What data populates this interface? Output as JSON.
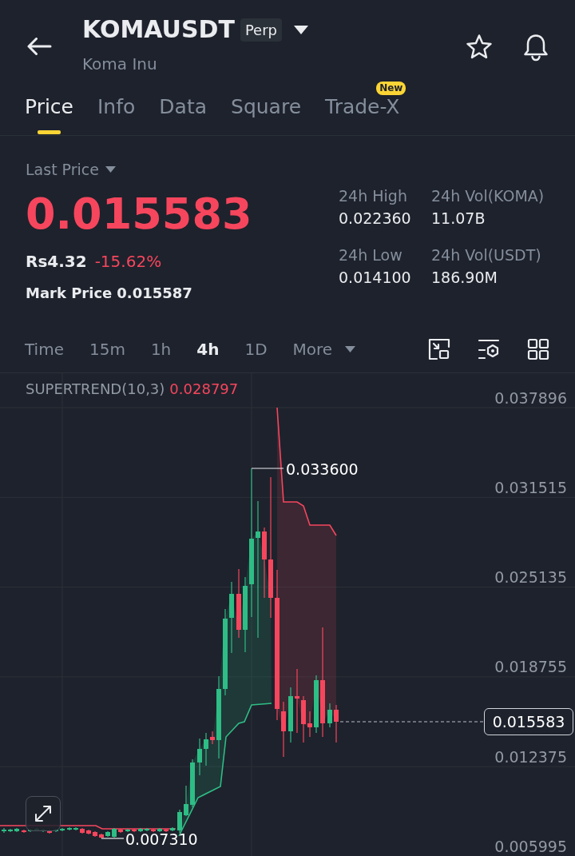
{
  "header": {
    "symbol": "KOMAUSDT",
    "contract_type": "Perp",
    "name": "Koma Inu"
  },
  "tabs": [
    {
      "label": "Price",
      "selected": true
    },
    {
      "label": "Info",
      "selected": false
    },
    {
      "label": "Data",
      "selected": false
    },
    {
      "label": "Square",
      "selected": false
    },
    {
      "label": "Trade-X",
      "selected": false,
      "badge": "New"
    }
  ],
  "price_panel": {
    "price_type": "Last Price",
    "last_price": "0.015583",
    "negative": true,
    "fiat_price": "Rs4.32",
    "change": "-15.62%",
    "mark_price_label": "Mark Price",
    "mark_price": "0.015587",
    "stats": [
      {
        "label": "24h High",
        "value": "0.022360"
      },
      {
        "label": "24h Vol(KOMA)",
        "value": "11.07B"
      },
      {
        "label": "24h Low",
        "value": "0.014100"
      },
      {
        "label": "24h Vol(USDT)",
        "value": "186.90M"
      }
    ]
  },
  "intervals": [
    {
      "label": "Time",
      "kind": "interval",
      "selected": false
    },
    {
      "label": "15m",
      "kind": "interval",
      "selected": false
    },
    {
      "label": "1h",
      "kind": "interval",
      "selected": false
    },
    {
      "label": "4h",
      "kind": "interval",
      "selected": true
    },
    {
      "label": "1D",
      "kind": "interval",
      "selected": false
    },
    {
      "label": "More",
      "kind": "menu",
      "selected": false
    }
  ],
  "chart": {
    "indicator": "SUPERTREND(10,3)",
    "indicator_value": "0.028797",
    "price_axis": [
      "0.037896",
      "0.031515",
      "0.025135",
      "0.018755",
      "0.012375",
      "0.005995"
    ],
    "high_label": "0.033600",
    "low_label": "0.007310",
    "current_price": "0.015583"
  }
}
